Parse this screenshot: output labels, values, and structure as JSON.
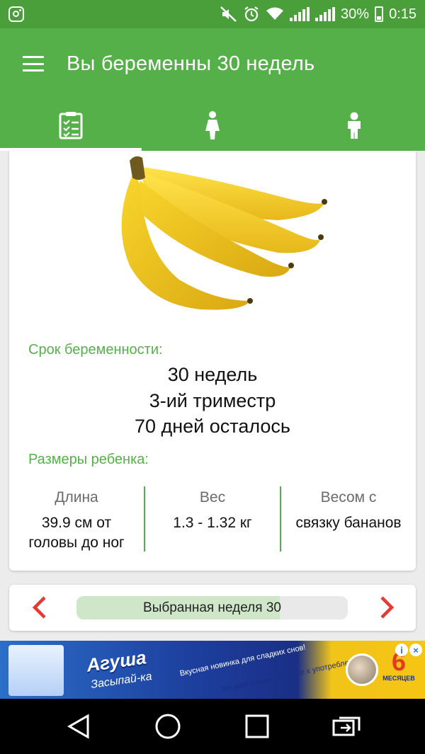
{
  "status_bar": {
    "battery_percent": "30%",
    "time": "0:15",
    "icons": [
      "instagram-icon",
      "mute-icon",
      "alarm-icon",
      "wifi-icon",
      "signal-icon",
      "signal-icon",
      "battery-icon"
    ]
  },
  "app_bar": {
    "title": "Вы беременны 30 недель",
    "menu_icon": "hamburger-menu-icon"
  },
  "tabs": [
    {
      "icon": "checklist-icon",
      "active": true
    },
    {
      "icon": "pregnant-woman-icon",
      "active": false
    },
    {
      "icon": "child-icon",
      "active": false
    }
  ],
  "card": {
    "image": "banana-bunch",
    "term_label": "Срок беременности:",
    "term_lines": [
      "30 недель",
      "3-ий триместр",
      "70 дней осталось"
    ],
    "size_label": "Размеры ребенка:",
    "stats": [
      {
        "head": "Длина",
        "value_lines": [
          "39.9 см от",
          "головы до ног"
        ]
      },
      {
        "head": "Вес",
        "value_lines": [
          "1.3 - 1.32 кг"
        ]
      },
      {
        "head": "Весом с",
        "value_lines": [
          "связку бананов"
        ]
      }
    ]
  },
  "week_selector": {
    "label": "Выбранная неделя 30",
    "progress": 0.75,
    "prev_icon": "chevron-left-icon",
    "next_icon": "chevron-right-icon"
  },
  "ad": {
    "brand": "Агуша",
    "sub": "Засыпай-ка",
    "slogan_line1": "Вкусная новинка для сладких снов!",
    "slogan_line2": "Жидкие кашки, готовые к употреблению",
    "age_number": "6",
    "age_unit": "МЕСЯЦЕВ",
    "info_icon": "i",
    "close_icon": "×"
  },
  "nav_bar": {
    "icons": [
      "back-icon",
      "home-icon",
      "recents-icon",
      "switch-icon"
    ]
  },
  "colors": {
    "primary": "#56b04a",
    "status": "#4a9f3b",
    "arrow": "#e53935"
  }
}
